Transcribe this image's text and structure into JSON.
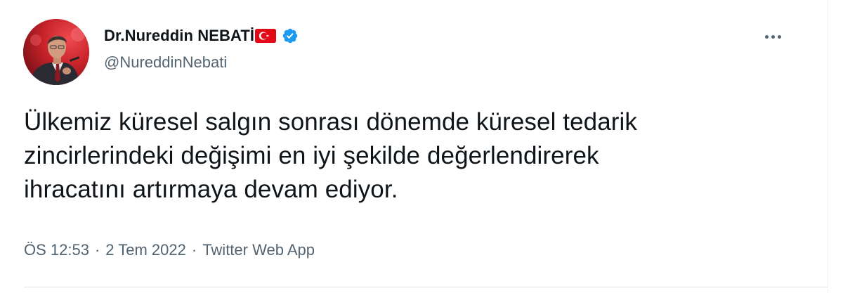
{
  "tweet": {
    "author": {
      "display_name": "Dr.Nureddin NEBATİ",
      "handle": "@NureddinNebati",
      "avatar_icon": "profile-photo",
      "flag_icon": "turkey-flag-icon",
      "verified_icon": "verified-badge-icon"
    },
    "more_icon": "more-options-icon",
    "text_lines": [
      "Ülkemiz küresel salgın sonrası dönemde küresel tedarik",
      "zincirlerindeki değişimi en iyi şekilde değerlendirerek",
      "ihracatını artırmaya devam ediyor."
    ],
    "meta": {
      "time": "ÖS 12:53",
      "separator": "·",
      "date": "2 Tem 2022",
      "source": "Twitter Web App"
    },
    "colors": {
      "text": "#0f1419",
      "secondary": "#536471",
      "verified": "#1d9bf0",
      "flag": "#e30a17"
    }
  }
}
